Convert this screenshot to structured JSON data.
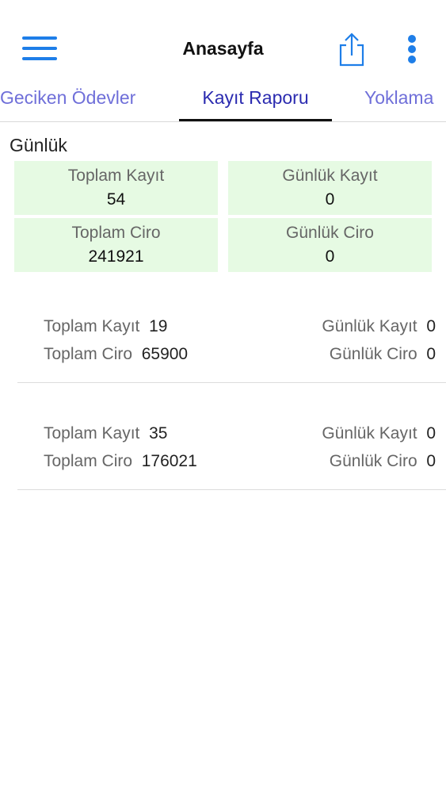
{
  "nav": {
    "title": "Anasayfa"
  },
  "tabs": [
    {
      "label": "Geciken Ödevler"
    },
    {
      "label": "Kayıt Raporu"
    },
    {
      "label": "Yoklama"
    }
  ],
  "section": {
    "title": "Günlük"
  },
  "summary": [
    {
      "label": "Toplam Kayıt",
      "value": "54"
    },
    {
      "label": "Günlük Kayıt",
      "value": "0"
    },
    {
      "label": "Toplam Ciro",
      "value": "241921"
    },
    {
      "label": "Günlük Ciro",
      "value": "0"
    }
  ],
  "items": [
    {
      "total_reg_label": "Toplam Kayıt",
      "total_reg_value": "19",
      "daily_reg_label": "Günlük Kayıt",
      "daily_reg_value": "0",
      "total_rev_label": "Toplam Ciro",
      "total_rev_value": "65900",
      "daily_rev_label": "Günlük Ciro",
      "daily_rev_value": "0"
    },
    {
      "total_reg_label": "Toplam Kayıt",
      "total_reg_value": "35",
      "daily_reg_label": "Günlük Kayıt",
      "daily_reg_value": "0",
      "total_rev_label": "Toplam Ciro",
      "total_rev_value": "176021",
      "daily_rev_label": "Günlük Ciro",
      "daily_rev_value": "0"
    }
  ],
  "colors": {
    "accent": "#1e7ee8",
    "tab_active": "#2b2bb0",
    "tab_inactive": "#6f6fd9",
    "card_bg": "#e6fae3"
  },
  "icons": {
    "menu": "hamburger-icon",
    "share": "share-icon",
    "more": "more-vertical-icon"
  }
}
